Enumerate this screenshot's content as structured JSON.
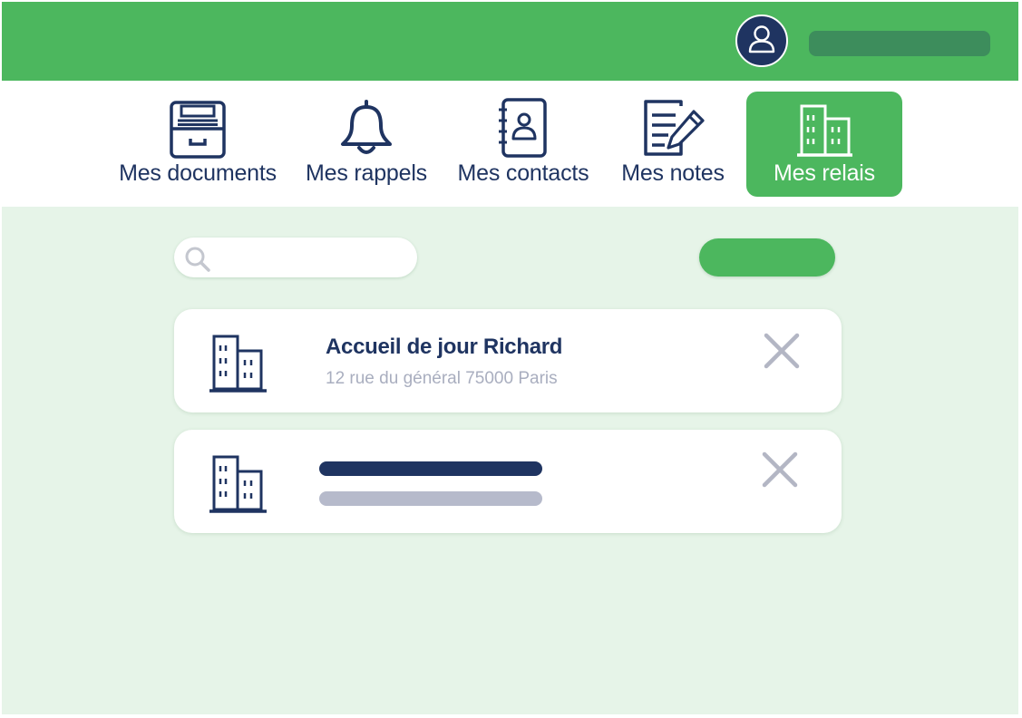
{
  "header": {
    "avatar_icon": "user-avatar-icon",
    "brand_color": "#4cb75e",
    "dark_color": "#1f3461"
  },
  "nav": {
    "items": [
      {
        "label": "Mes documents",
        "icon": "filing-cabinet-icon",
        "active": false
      },
      {
        "label": "Mes rappels",
        "icon": "bell-icon",
        "active": false
      },
      {
        "label": "Mes contacts",
        "icon": "contact-book-icon",
        "active": false
      },
      {
        "label": "Mes notes",
        "icon": "note-pencil-icon",
        "active": false
      },
      {
        "label": "Mes relais",
        "icon": "buildings-icon",
        "active": true
      }
    ]
  },
  "search": {
    "placeholder": "",
    "icon": "search-icon"
  },
  "relais": [
    {
      "name": "Accueil de jour Richard",
      "address": "12 rue du général 75000 Paris",
      "icon": "buildings-icon",
      "remove_icon": "close-icon"
    },
    {
      "placeholder": true,
      "icon": "buildings-icon",
      "remove_icon": "close-icon"
    }
  ]
}
